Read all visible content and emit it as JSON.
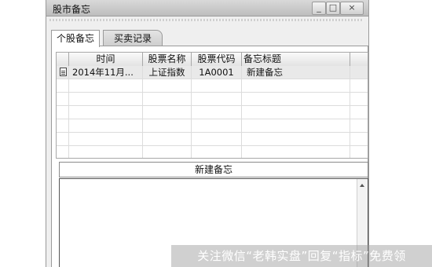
{
  "window": {
    "title": "股市备忘"
  },
  "titlebar_buttons": {
    "min": "_",
    "max": "□",
    "close": "×"
  },
  "tabs": [
    {
      "label": "个股备忘",
      "active": true
    },
    {
      "label": "买卖记录",
      "active": false
    }
  ],
  "table": {
    "headers": [
      "时间",
      "股票名称",
      "股票代码",
      "备忘标题"
    ],
    "rows": [
      {
        "icon": "document-icon",
        "time": "2014年11月...",
        "name": "上证指数",
        "code": "1A0001",
        "title": "新建备忘"
      }
    ]
  },
  "memo_title": "新建备忘",
  "memo_body": "",
  "watermark": "关注微信“老韩实盘”回复“指标”免费领"
}
